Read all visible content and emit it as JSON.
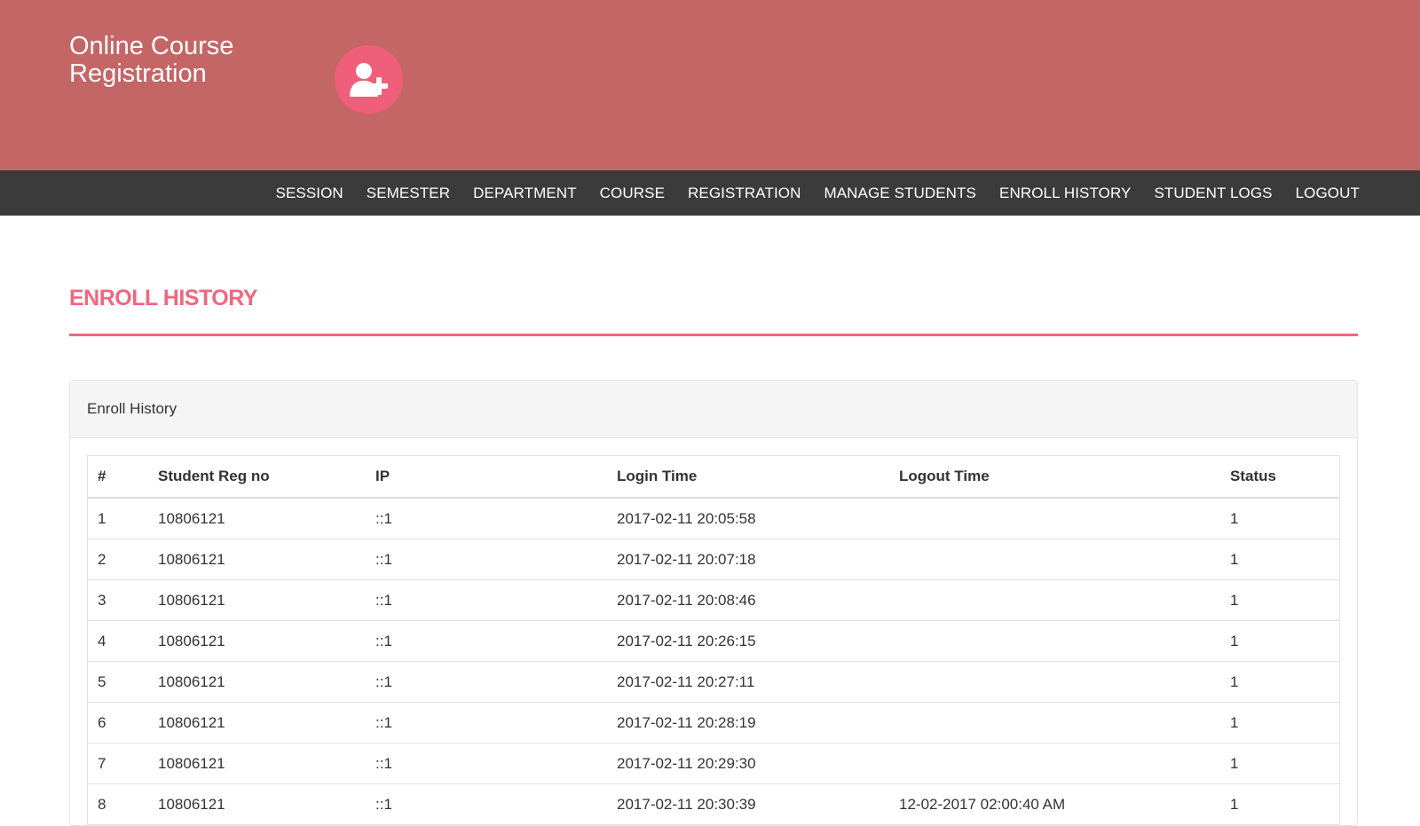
{
  "brand": {
    "title": "Online Course Registration",
    "icon": "user-plus-icon",
    "header_color": "#c46666",
    "avatar_color": "#f05f7a"
  },
  "nav": {
    "background": "#3b3b3b",
    "items": [
      {
        "label": "SESSION"
      },
      {
        "label": "SEMESTER"
      },
      {
        "label": "DEPARTMENT"
      },
      {
        "label": "COURSE"
      },
      {
        "label": "REGISTRATION"
      },
      {
        "label": "MANAGE STUDENTS"
      },
      {
        "label": "ENROLL HISTORY"
      },
      {
        "label": "STUDENT LOGS"
      },
      {
        "label": "LOGOUT"
      }
    ]
  },
  "page": {
    "title": "ENROLL HISTORY",
    "accent_color": "#f0677f"
  },
  "panel": {
    "heading": "Enroll History"
  },
  "table": {
    "columns": [
      "#",
      "Student Reg no",
      "IP",
      "Login Time",
      "Logout Time",
      "Status"
    ],
    "rows": [
      {
        "num": "1",
        "reg": "10806121",
        "ip": "::1",
        "login": "2017-02-11 20:05:58",
        "logout": "",
        "status": "1"
      },
      {
        "num": "2",
        "reg": "10806121",
        "ip": "::1",
        "login": "2017-02-11 20:07:18",
        "logout": "",
        "status": "1"
      },
      {
        "num": "3",
        "reg": "10806121",
        "ip": "::1",
        "login": "2017-02-11 20:08:46",
        "logout": "",
        "status": "1"
      },
      {
        "num": "4",
        "reg": "10806121",
        "ip": "::1",
        "login": "2017-02-11 20:26:15",
        "logout": "",
        "status": "1"
      },
      {
        "num": "5",
        "reg": "10806121",
        "ip": "::1",
        "login": "2017-02-11 20:27:11",
        "logout": "",
        "status": "1"
      },
      {
        "num": "6",
        "reg": "10806121",
        "ip": "::1",
        "login": "2017-02-11 20:28:19",
        "logout": "",
        "status": "1"
      },
      {
        "num": "7",
        "reg": "10806121",
        "ip": "::1",
        "login": "2017-02-11 20:29:30",
        "logout": "",
        "status": "1"
      },
      {
        "num": "8",
        "reg": "10806121",
        "ip": "::1",
        "login": "2017-02-11 20:30:39",
        "logout": "12-02-2017 02:00:40 AM",
        "status": "1"
      }
    ]
  }
}
